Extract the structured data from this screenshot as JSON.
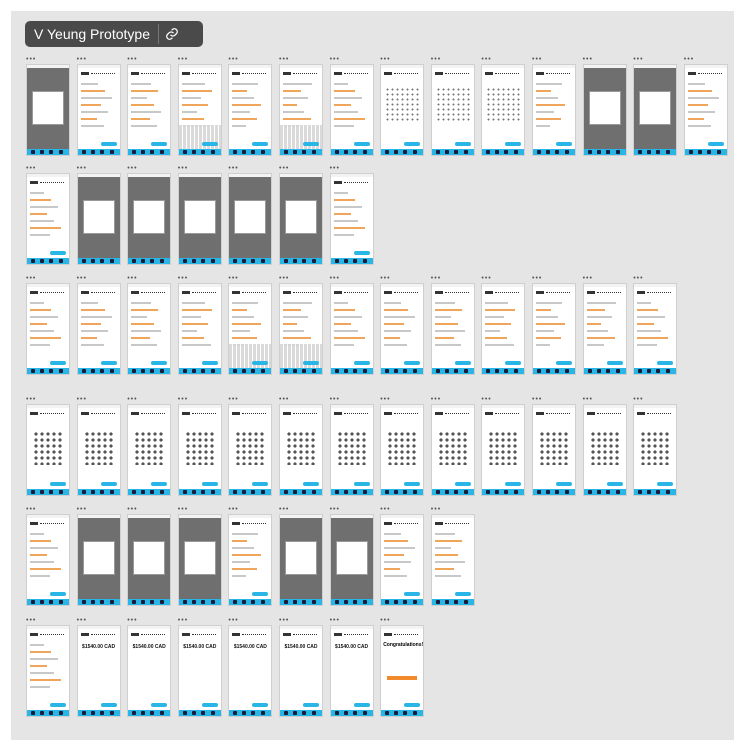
{
  "board": {
    "title": "V Yeung Prototype",
    "link_icon": "link-icon"
  },
  "frame_label": "•••",
  "rows": [
    {
      "count": 14,
      "kinds": [
        "dark",
        "home",
        "form",
        "keyboard",
        "form",
        "keyboard",
        "form",
        "calendar",
        "calendar",
        "calendar",
        "form",
        "dark",
        "dark",
        "form"
      ]
    },
    {
      "count": 7,
      "kinds": [
        "form",
        "dark",
        "dark",
        "dark",
        "dark",
        "dark",
        "form"
      ]
    },
    {
      "count": 13,
      "kinds": [
        "form",
        "form",
        "form",
        "form",
        "keyboard",
        "keyboard",
        "form",
        "form",
        "form",
        "form",
        "form",
        "form",
        "form"
      ]
    },
    {
      "count": 13,
      "kinds": [
        "seats",
        "seats",
        "seats",
        "seats",
        "seats",
        "seats",
        "seats",
        "seats",
        "seats",
        "seats",
        "seats",
        "seats",
        "seats"
      ]
    },
    {
      "count": 9,
      "kinds": [
        "form",
        "dark",
        "dark",
        "dark",
        "form",
        "dark",
        "dark",
        "form",
        "form"
      ]
    },
    {
      "count": 8,
      "kinds": [
        "receipt",
        "price",
        "price",
        "price",
        "price",
        "price",
        "price",
        "congrats"
      ]
    }
  ],
  "price_text": "$1540.00 CAD",
  "congrats_text": "Congratulations!",
  "colors": {
    "accent": "#29b6e6",
    "orange": "#f0a65a",
    "canvas": "#e5e5e5",
    "pill": "#4a4a4a"
  }
}
